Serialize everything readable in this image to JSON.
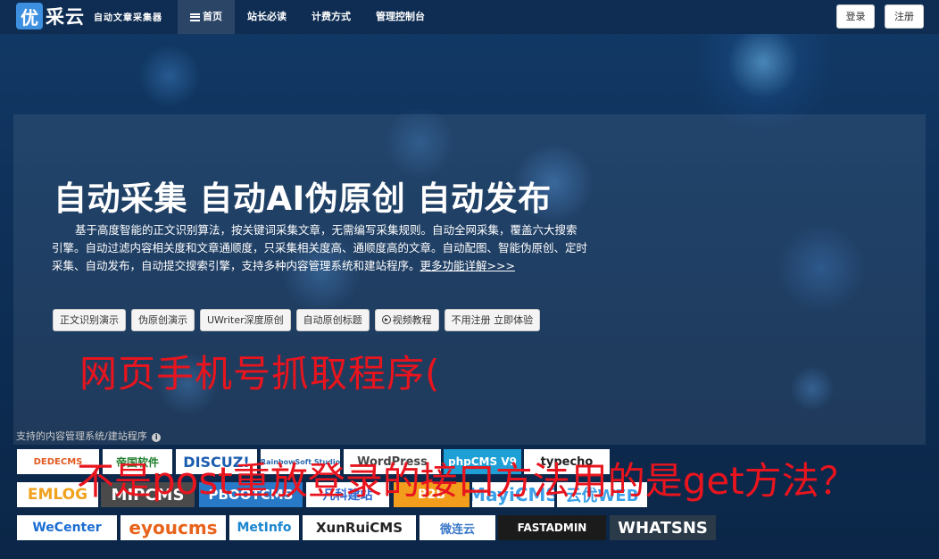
{
  "nav": {
    "logo_mark": "优",
    "logo_name": "采云",
    "logo_slogan": "自动文章采集器",
    "links": [
      {
        "icon": "list-icon",
        "label": "首页"
      },
      {
        "label": "站长必读"
      },
      {
        "label": "计费方式"
      },
      {
        "label": "管理控制台"
      }
    ],
    "login_label": "登录",
    "register_label": "注册"
  },
  "hero": {
    "title": "自动采集 自动AI伪原创 自动发布",
    "description": "基于高度智能的正文识别算法，按关键词采集文章，无需编写采集规则。自动全网采集，覆盖六大搜索引擎。自动过滤内容相关度和文章通顺度，只采集相关度高、通顺度高的文章。自动配图、智能伪原创、定时采集、自动发布，自动提交搜索引擎，支持多种内容管理系统和建站程序。",
    "more_link": "更多功能详解>>>",
    "buttons": [
      "正文识别演示",
      "伪原创演示",
      "UWriter深度原创",
      "自动原创标题",
      "视频教程",
      "不用注册 立即体验"
    ],
    "video_icon": "play-circle-icon"
  },
  "overlay_text_1": "网页手机号抓取程序(",
  "overlay_text_2": "不是post重放登录的接口方法用的是get方法？",
  "supported": {
    "label": "支持的内容管理系统/建站程序",
    "icon": "info-icon"
  },
  "cms_logos": [
    {
      "name": "DEDECMS",
      "bg": "#ffffff",
      "fg": "#e05a20"
    },
    {
      "name": "帝国软件",
      "bg": "#ffffff",
      "fg": "#1f7d2c"
    },
    {
      "name": "DISCUZ!",
      "bg": "#ffffff",
      "fg": "#1a5cb0"
    },
    {
      "name": "RainbowSoft Studio",
      "bg": "#ffffff",
      "fg": "#2d6bb0"
    },
    {
      "name": "WordPress",
      "bg": "#ffffff",
      "fg": "#464646"
    },
    {
      "name": "phpCMS V9",
      "bg": "#1ea0d6",
      "fg": "#ffffff"
    },
    {
      "name": "typecho",
      "bg": "#ffffff",
      "fg": "#222222"
    },
    {
      "name": "EMLOG",
      "bg": "#ffffff",
      "fg": "#f0a21e"
    },
    {
      "name": "MIPCMS",
      "bg": "#4a4a4a",
      "fg": "#ffffff"
    },
    {
      "name": "PBOOTCMS",
      "bg": "#2879c8",
      "fg": "#ffffff"
    },
    {
      "name": "凡科建站",
      "bg": "#ffffff",
      "fg": "#2d6ad0"
    },
    {
      "name": "B2B",
      "bg": "#f29d1b",
      "fg": "#ffffff"
    },
    {
      "name": "MayiCMS",
      "bg": "#ffffff",
      "fg": "#3aa0e8"
    },
    {
      "name": "云优WEB",
      "bg": "#ffffff",
      "fg": "#3aa0e8"
    },
    {
      "name": "WeCenter",
      "bg": "#ffffff",
      "fg": "#1b6ed2"
    },
    {
      "name": "eyoucms",
      "bg": "#ffffff",
      "fg": "#e8631b"
    },
    {
      "name": "MetInfo",
      "bg": "#ffffff",
      "fg": "#1a86d0"
    },
    {
      "name": "XunRuiCMS",
      "bg": "#ffffff",
      "fg": "#222222"
    },
    {
      "name": "微连云",
      "bg": "#ffffff",
      "fg": "#3a78c8"
    },
    {
      "name": "FASTADMIN",
      "bg": "#1b1b1b",
      "fg": "#ffffff"
    },
    {
      "name": "WHATSNS",
      "bg": "#2b3a48",
      "fg": "#ffffff"
    }
  ]
}
